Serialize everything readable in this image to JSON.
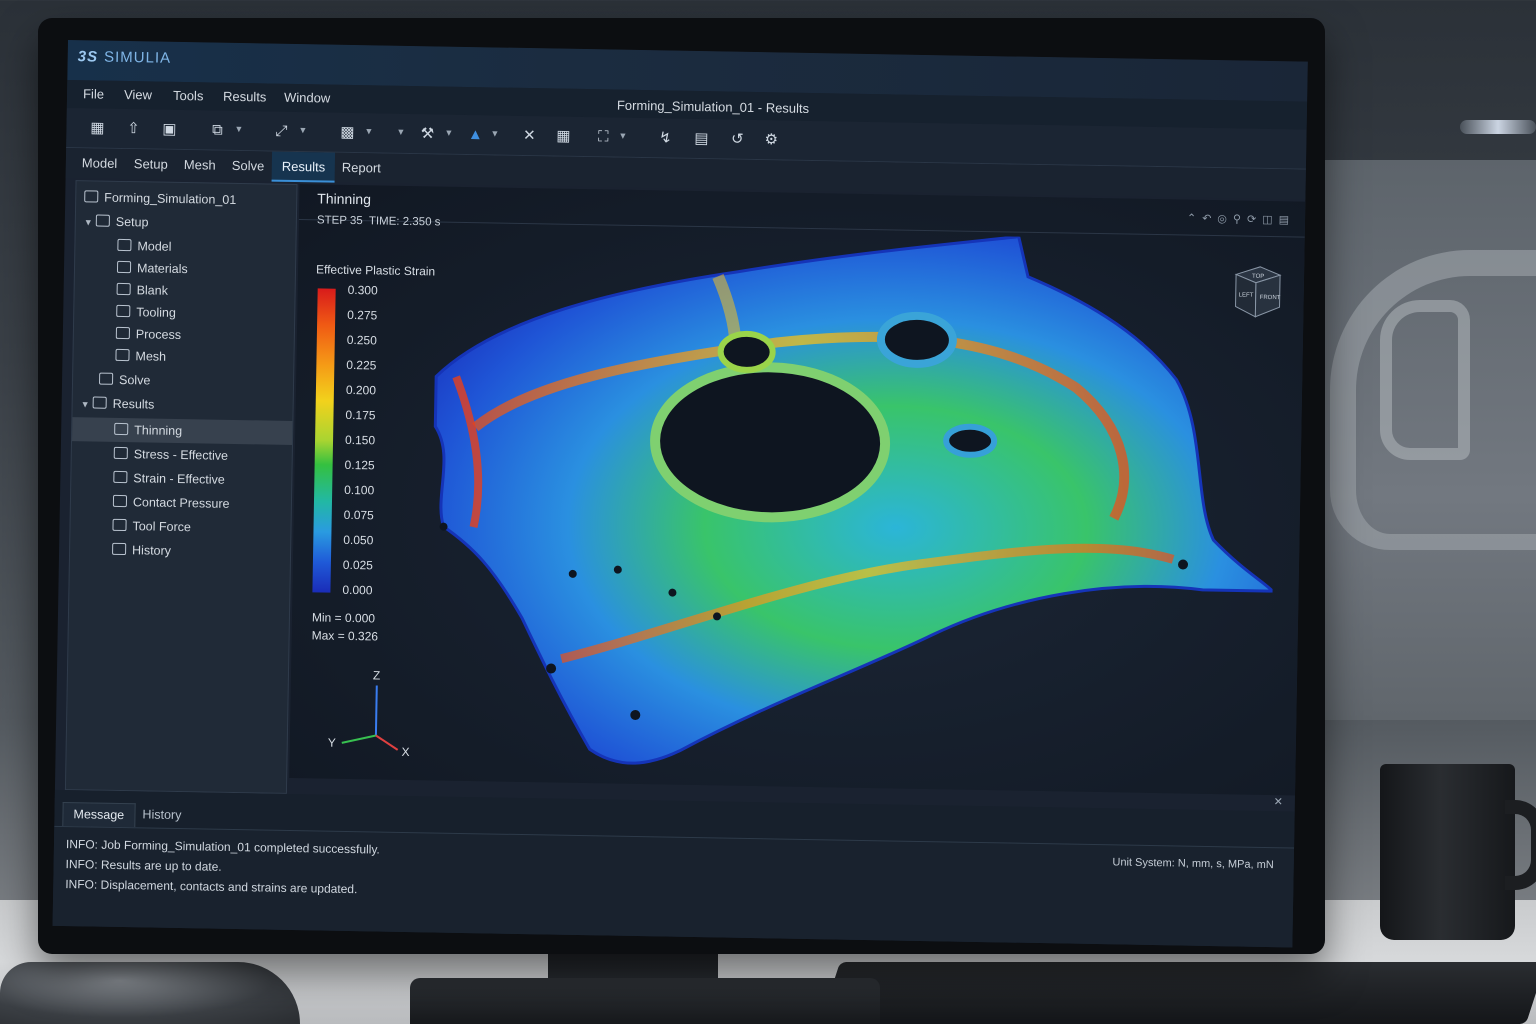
{
  "app": {
    "brand": "SIMULIA",
    "document_title": "Forming_Simulation_01 - Results",
    "window_controls": [
      "minimize-icon",
      "close-icon"
    ]
  },
  "menu": [
    "File",
    "View",
    "Tools",
    "Results",
    "Window"
  ],
  "toolbar_icons": [
    "new-icon",
    "open-icon",
    "save-icon",
    "copy-icon",
    "fit-icon",
    "part-icon",
    "tool-icon",
    "shade-icon",
    "cross-icon",
    "select-icon",
    "zoom-box-icon",
    "probe-icon",
    "screenshot-icon",
    "export-icon",
    "settings-icon"
  ],
  "workflow_tabs": [
    {
      "label": "Model",
      "active": false
    },
    {
      "label": "Setup",
      "active": false
    },
    {
      "label": "Mesh",
      "active": false
    },
    {
      "label": "Solve",
      "active": false
    },
    {
      "label": "Results",
      "active": true
    },
    {
      "label": "Report",
      "active": false
    }
  ],
  "tree": {
    "root": "Forming_Simulation_01",
    "items": [
      {
        "label": "Setup",
        "level": 1,
        "expanded": true
      },
      {
        "label": "Model",
        "level": 2
      },
      {
        "label": "Materials",
        "level": 2
      },
      {
        "label": "Blank",
        "level": 2
      },
      {
        "label": "Tooling",
        "level": 2
      },
      {
        "label": "Process",
        "level": 2
      },
      {
        "label": "Mesh",
        "level": 2
      },
      {
        "label": "Solve",
        "level": 1
      },
      {
        "label": "Results",
        "level": 1,
        "expanded": true
      },
      {
        "label": "Thinning",
        "level": 2,
        "selected": true
      },
      {
        "label": "Stress - Effective",
        "level": 2
      },
      {
        "label": "Strain - Effective",
        "level": 2
      },
      {
        "label": "Contact Pressure",
        "level": 2
      },
      {
        "label": "Tool Force",
        "level": 2
      },
      {
        "label": "History",
        "level": 2
      }
    ]
  },
  "viewport": {
    "title": "Thinning",
    "step": "STEP 35",
    "time": "TIME: 2.350 s",
    "legend_title": "Effective Plastic Strain",
    "legend_values": [
      "0.300",
      "0.275",
      "0.250",
      "0.225",
      "0.200",
      "0.175",
      "0.150",
      "0.125",
      "0.100",
      "0.075",
      "0.050",
      "0.025",
      "0.000"
    ],
    "min": "Min = 0.000",
    "max": "Max = 0.326",
    "triad": {
      "z": "Z",
      "y": "Y",
      "x": "X"
    },
    "viewcube": {
      "top": "TOP",
      "left": "LEFT",
      "front": "FRONT"
    },
    "colors": {
      "high": "#d81b1b",
      "mid": "#34c040",
      "low": "#1a2cb8"
    }
  },
  "messages": {
    "tabs": [
      {
        "label": "Message",
        "active": true
      },
      {
        "label": "History",
        "active": false
      }
    ],
    "lines": [
      "INFO: Job Forming_Simulation_01 completed successfully.",
      "INFO: Results are up to date.",
      "INFO: Displacement, contacts and strains are updated."
    ],
    "unit_system": "Unit System: N, mm, s, MPa, mN"
  }
}
